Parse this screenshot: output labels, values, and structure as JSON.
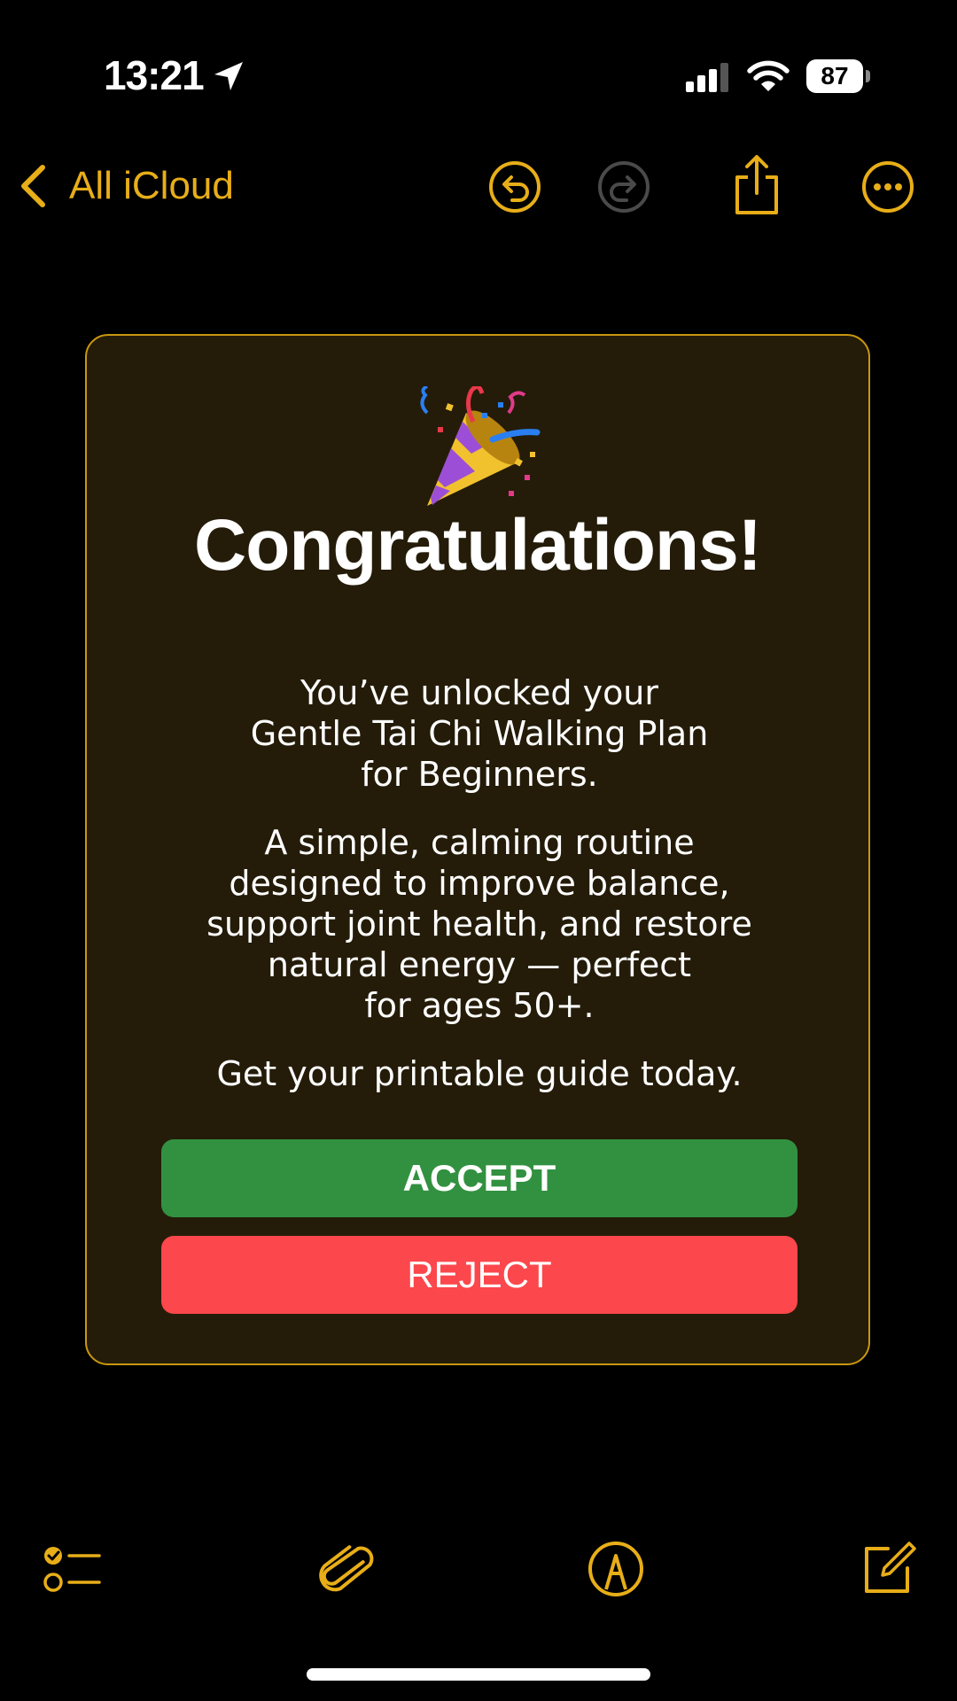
{
  "status_bar": {
    "time": "13:21",
    "battery_level": "87",
    "icons": [
      "location-arrow-icon",
      "cellular-signal-icon",
      "wifi-icon",
      "battery-icon"
    ]
  },
  "nav": {
    "back_label": "All iCloud",
    "icons": [
      "undo-icon",
      "redo-icon",
      "share-icon",
      "more-icon"
    ]
  },
  "card": {
    "emoji": "party-popper-icon",
    "title": "Congratulations!",
    "paragraph_1": "You’ve unlocked your\nGentle Tai Chi Walking Plan\nfor Beginners.",
    "paragraph_2": "A simple, calming routine\ndesigned to improve balance,\nsupport joint health, and restore\nnatural energy — perfect\nfor ages 50+.",
    "paragraph_3": "Get your printable guide today.",
    "accept_label": "ACCEPT",
    "reject_label": "REJECT"
  },
  "toolbar": {
    "icons": [
      "checklist-icon",
      "attachment-icon",
      "markup-icon",
      "compose-icon"
    ]
  },
  "colors": {
    "accent": "#e8ae18",
    "card_background": "#241c09",
    "card_border": "#c9970f",
    "accept": "#329140",
    "reject": "#fc474c",
    "background": "#000000"
  }
}
